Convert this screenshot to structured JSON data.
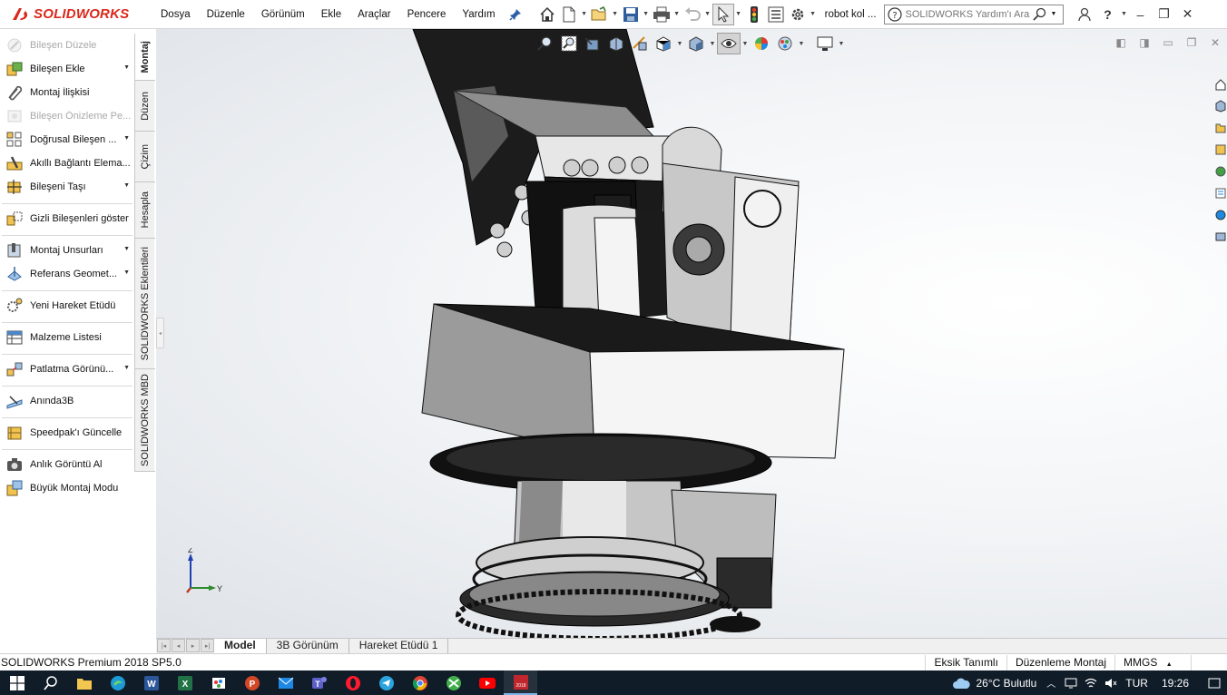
{
  "app": {
    "brand": "SOLIDWORKS"
  },
  "menu": {
    "items": [
      "Dosya",
      "Düzenle",
      "Görünüm",
      "Ekle",
      "Araçlar",
      "Pencere",
      "Yardım"
    ]
  },
  "document": {
    "title": "robot kol ..."
  },
  "search": {
    "placeholder": "SOLIDWORKS Yardım'ı Ara"
  },
  "command_manager": {
    "items": [
      {
        "label": "Bileşen Düzele",
        "icon": "edit-component-icon",
        "disabled": true,
        "dropdown": false
      },
      {
        "label": "Bileşen Ekle",
        "icon": "insert-component-icon",
        "disabled": false,
        "dropdown": true
      },
      {
        "label": "Montaj İlişkisi",
        "icon": "mate-icon",
        "disabled": false,
        "dropdown": false
      },
      {
        "label": "Bileşen Önizleme Pe...",
        "icon": "component-preview-icon",
        "disabled": true,
        "dropdown": false
      },
      {
        "label": "Doğrusal Bileşen ...",
        "icon": "linear-pattern-icon",
        "disabled": false,
        "dropdown": true
      },
      {
        "label": "Akıllı Bağlantı Elema...",
        "icon": "smart-fasteners-icon",
        "disabled": false,
        "dropdown": false
      },
      {
        "label": "Bileşeni Taşı",
        "icon": "move-component-icon",
        "disabled": false,
        "dropdown": true
      },
      {
        "label": "Gizli Bileşenleri göster",
        "icon": "show-hidden-icon",
        "disabled": false,
        "dropdown": false
      },
      {
        "label": "Montaj Unsurları",
        "icon": "assembly-features-icon",
        "disabled": false,
        "dropdown": true
      },
      {
        "label": "Referans Geomet...",
        "icon": "reference-geometry-icon",
        "disabled": false,
        "dropdown": true
      },
      {
        "label": "Yeni Hareket Etüdü",
        "icon": "motion-study-icon",
        "disabled": false,
        "dropdown": false
      },
      {
        "label": "Malzeme Listesi",
        "icon": "bom-icon",
        "disabled": false,
        "dropdown": false
      },
      {
        "label": "Patlatma Görünü...",
        "icon": "exploded-view-icon",
        "disabled": false,
        "dropdown": true
      },
      {
        "label": "Anında3B",
        "icon": "instant3d-icon",
        "disabled": false,
        "dropdown": false
      },
      {
        "label": "Speedpak'ı Güncelle",
        "icon": "speedpak-icon",
        "disabled": false,
        "dropdown": false
      },
      {
        "label": "Anlık Görüntü Al",
        "icon": "camera-icon",
        "disabled": false,
        "dropdown": false
      },
      {
        "label": "Büyük Montaj Modu",
        "icon": "large-assembly-icon",
        "disabled": false,
        "dropdown": false
      }
    ]
  },
  "vertical_tabs": [
    "Montaj",
    "Düzen",
    "Çizim",
    "Hesapla",
    "SOLIDWORKS Eklentileri",
    "SOLIDWORKS MBD"
  ],
  "triad": {
    "z": "Z",
    "y": "Y"
  },
  "bottom_tabs": [
    "Model",
    "3B Görünüm",
    "Hareket Etüdü 1"
  ],
  "status": {
    "app_version": "SOLIDWORKS Premium 2018 SP5.0",
    "definition": "Eksik Tanımlı",
    "mode": "Düzenleme Montaj",
    "units": "MMGS"
  },
  "taskbar": {
    "weather": "26°C  Bulutlu",
    "language": "TUR",
    "time": "19:26"
  },
  "colors": {
    "brand_red": "#da291c",
    "taskbar": "#101c28"
  }
}
